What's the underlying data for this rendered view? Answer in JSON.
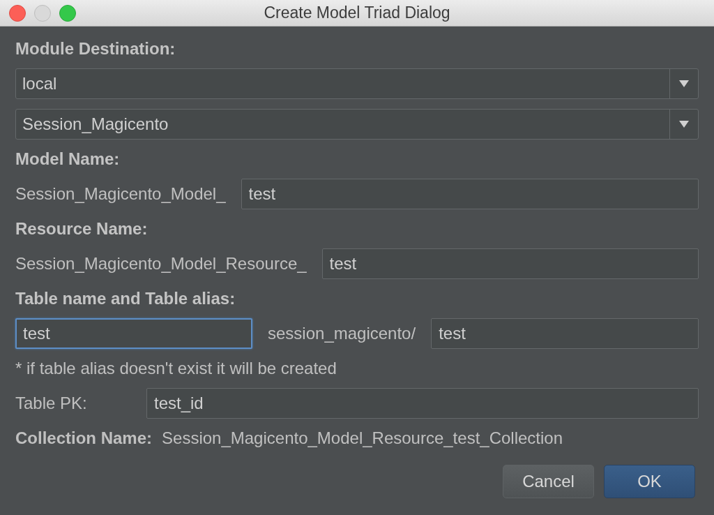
{
  "window": {
    "title": "Create Model Triad Dialog"
  },
  "module_destination": {
    "label": "Module Destination:",
    "dropdowns": [
      {
        "value": "local"
      },
      {
        "value": "Session_Magicento"
      }
    ]
  },
  "model_name": {
    "label": "Model Name:",
    "prefix": "Session_Magicento_Model_",
    "field": {
      "value": "test",
      "focused": false
    }
  },
  "resource_name": {
    "label": "Resource Name:",
    "prefix": "Session_Magicento_Model_Resource_",
    "field": {
      "value": "test",
      "focused": false
    }
  },
  "table": {
    "label": "Table name and Table alias:",
    "table_name": {
      "value": "test",
      "focused": true
    },
    "alias_prefix": "session_magicento/",
    "alias": {
      "value": "test",
      "focused": false
    },
    "note": "* if table alias doesn't exist it will be created"
  },
  "table_pk": {
    "label": "Table PK:",
    "field": {
      "value": "test_id",
      "focused": false
    }
  },
  "collection": {
    "label": "Collection Name:",
    "value": "Session_Magicento_Model_Resource_test_Collection"
  },
  "buttons": [
    {
      "label": "Cancel",
      "default": false
    },
    {
      "label": "OK",
      "default": true
    }
  ]
}
